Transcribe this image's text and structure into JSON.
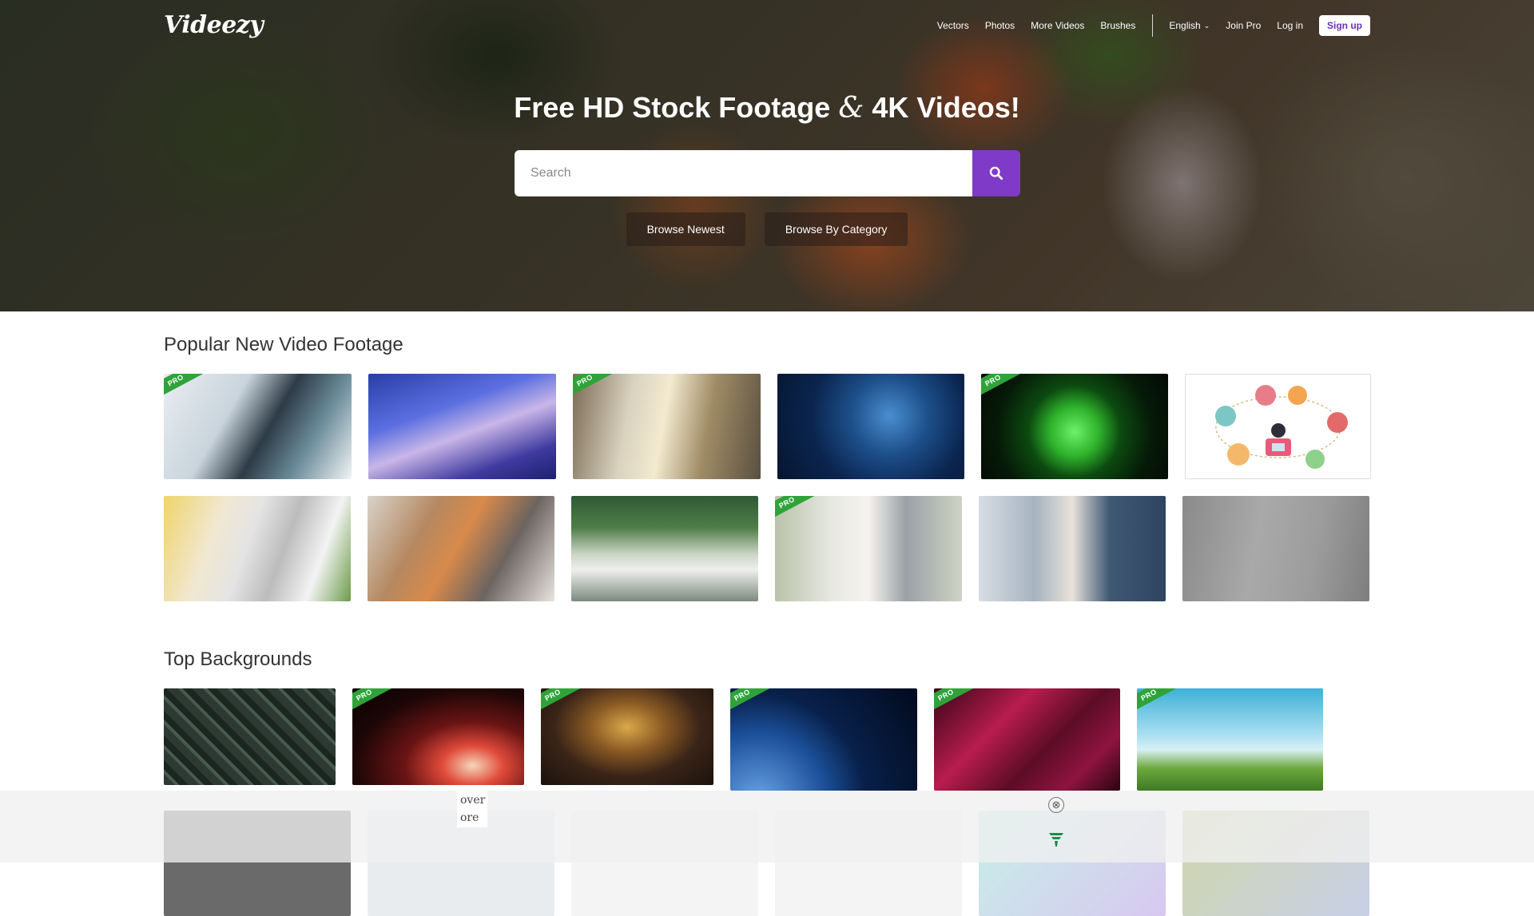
{
  "brand": {
    "logo": "Videezy"
  },
  "nav": {
    "links": [
      "Vectors",
      "Photos",
      "More Videos",
      "Brushes"
    ],
    "language": "English",
    "join_pro": "Join Pro",
    "login": "Log in",
    "signup": "Sign up"
  },
  "hero": {
    "title_part1": "Free HD Stock Footage",
    "title_amp": "&",
    "title_part2": "4K Videos!",
    "search_placeholder": "Search",
    "browse_newest": "Browse Newest",
    "browse_category": "Browse By Category"
  },
  "popular": {
    "title": "Popular New Video Footage",
    "pro_label": "PRO",
    "row1": [
      {
        "pro": true,
        "subject": "scientist at microscope"
      },
      {
        "pro": false,
        "subject": "lab test tubes blue light"
      },
      {
        "pro": true,
        "subject": "laboratory flask"
      },
      {
        "pro": false,
        "subject": "blue virus cells"
      },
      {
        "pro": true,
        "subject": "green virus cell"
      },
      {
        "pro": false,
        "subject": "online shopping illustration"
      }
    ],
    "row2": [
      {
        "pro": false,
        "subject": "typing on laptop"
      },
      {
        "pro": false,
        "subject": "couple on sofa"
      },
      {
        "pro": false,
        "subject": "woman working on terrace"
      },
      {
        "pro": true,
        "subject": "woman in mask thumbs up"
      },
      {
        "pro": false,
        "subject": "stressed man at laptop"
      },
      {
        "pro": false,
        "subject": "blurred office scene"
      }
    ]
  },
  "backgrounds": {
    "title": "Top Backgrounds",
    "row1": [
      {
        "pro": false,
        "subject": "3d maze"
      },
      {
        "pro": true,
        "subject": "particle tunnel"
      },
      {
        "pro": true,
        "subject": "golden bokeh"
      },
      {
        "pro": true,
        "subject": "earth from space"
      },
      {
        "pro": true,
        "subject": "red polygons"
      },
      {
        "pro": true,
        "subject": "sunny landscape"
      }
    ]
  },
  "ad": {
    "text_line1": "over",
    "text_line2": "ore",
    "close": "⊗"
  },
  "colors": {
    "accent": "#7f3bc8",
    "pro_badge": "#2fa33a"
  }
}
